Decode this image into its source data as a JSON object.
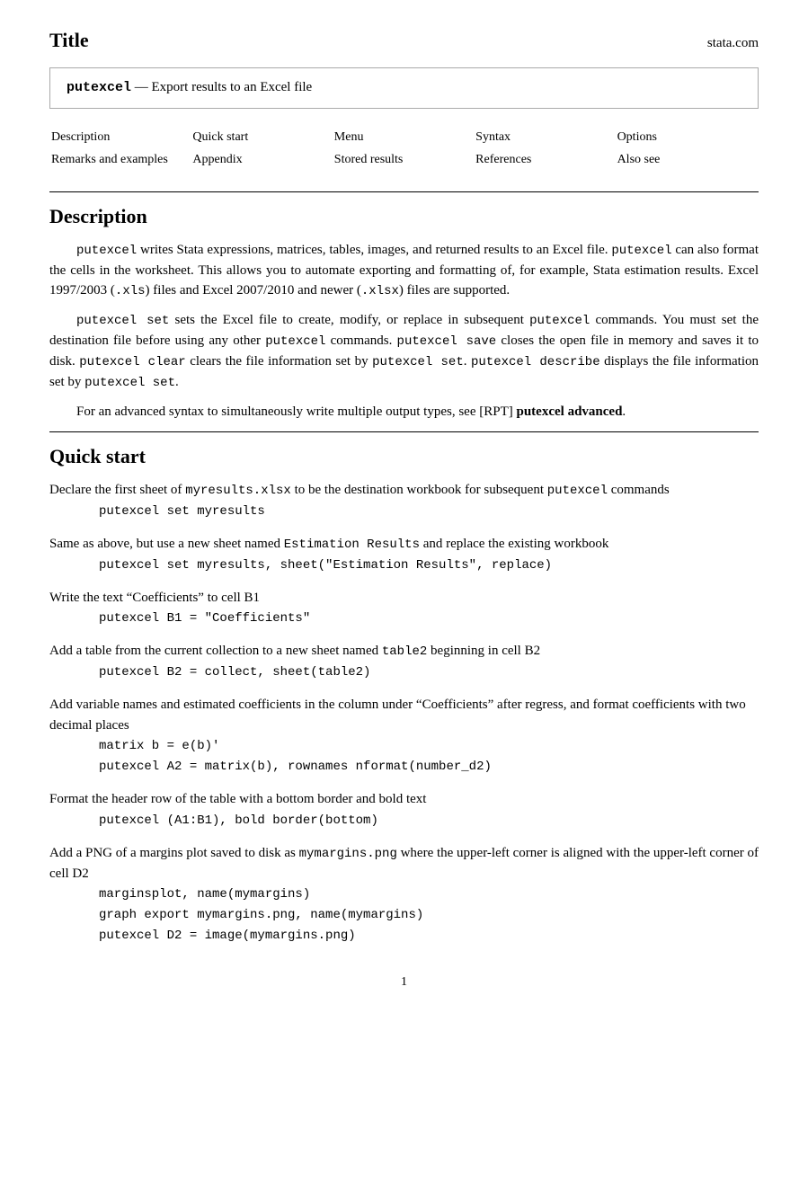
{
  "header": {
    "title": "Title",
    "brand": "stata.com"
  },
  "title_box": {
    "cmd": "putexcel",
    "dash": "—",
    "description": "Export results to an Excel file"
  },
  "nav": {
    "rows": [
      [
        "Description",
        "Quick start",
        "Menu",
        "Syntax",
        "Options"
      ],
      [
        "Remarks and examples",
        "Appendix",
        "Stored results",
        "References",
        "Also see"
      ]
    ]
  },
  "description": {
    "heading": "Description",
    "paras": [
      "putexcel writes Stata expressions, matrices, tables, images, and returned results to an Excel file. putexcel can also format the cells in the worksheet. This allows you to automate exporting and formatting of, for example, Stata estimation results. Excel 1997/2003 (.xls) files and Excel 2007/2010 and newer (.xlsx) files are supported.",
      "putexcel set sets the Excel file to create, modify, or replace in subsequent putexcel commands. You must set the destination file before using any other putexcel commands. putexcel save closes the open file in memory and saves it to disk. putexcel clear clears the file information set by putexcel set. putexcel describe displays the file information set by putexcel set.",
      "For an advanced syntax to simultaneously write multiple output types, see [RPT] putexcel advanced."
    ]
  },
  "quickstart": {
    "heading": "Quick start",
    "items": [
      {
        "desc": "Declare the first sheet of myresults.xlsx to be the destination workbook for subsequent putexcel commands",
        "code": [
          "putexcel set myresults"
        ]
      },
      {
        "desc": "Same as above, but use a new sheet named Estimation Results and replace the existing workbook",
        "code": [
          "putexcel set myresults, sheet(\"Estimation Results\", replace)"
        ]
      },
      {
        "desc": "Write the text “Coefficients” to cell B1",
        "code": [
          "putexcel B1 = \"Coefficients\""
        ]
      },
      {
        "desc": "Add a table from the current collection to a new sheet named table2 beginning in cell B2",
        "code": [
          "putexcel B2 = collect, sheet(table2)"
        ]
      },
      {
        "desc": "Add variable names and estimated coefficients in the column under “Coefficients” after regress, and format coefficients with two decimal places",
        "code": [
          "matrix b = e(b)'",
          "putexcel A2 = matrix(b), rownames nformat(number_d2)"
        ]
      },
      {
        "desc": "Format the header row of the table with a bottom border and bold text",
        "code": [
          "putexcel (A1:B1), bold border(bottom)"
        ]
      },
      {
        "desc": "Add a PNG of a margins plot saved to disk as mymargins.png where the upper-left corner is aligned with the upper-left corner of cell D2",
        "code": [
          "marginsplot, name(mymargins)",
          "graph export mymargins.png, name(mymargins)",
          "putexcel D2 = image(mymargins.png)"
        ]
      }
    ]
  },
  "footer": {
    "page_number": "1"
  }
}
